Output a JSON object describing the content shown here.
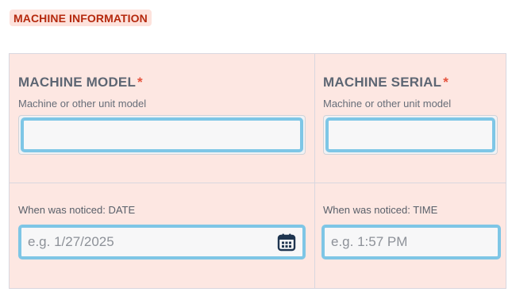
{
  "section": {
    "title": "MACHINE INFORMATION"
  },
  "fields": {
    "machine_model": {
      "label": "MACHINE MODEL",
      "required_marker": "*",
      "hint": "Machine or other unit model",
      "value": ""
    },
    "machine_serial": {
      "label": "MACHINE SERIAL",
      "required_marker": "*",
      "hint": "Machine or other unit model",
      "value": ""
    },
    "noticed_date": {
      "label": "When was noticed: DATE",
      "placeholder": "e.g. 1/27/2025",
      "icon": "calendar-icon"
    },
    "noticed_time": {
      "label": "When was noticed: TIME",
      "placeholder": "e.g. 1:57 PM"
    }
  },
  "colors": {
    "section_title": "#b5290e",
    "section_bg": "#fde2dc",
    "form_bg": "#fde7e2",
    "focus_ring": "#7ec6e6",
    "required": "#e5533d",
    "calendar_icon": "#1f3550"
  }
}
